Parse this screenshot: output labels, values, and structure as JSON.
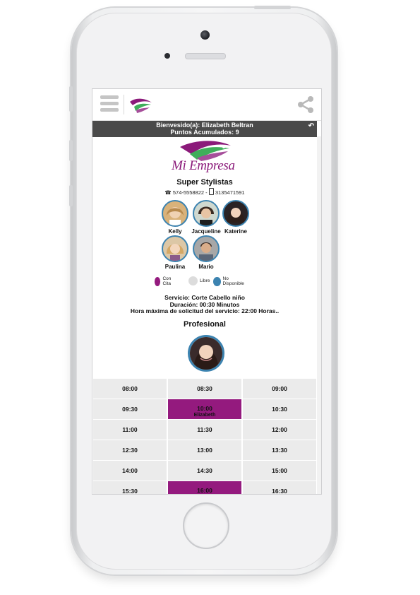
{
  "app": {
    "welcome_line1": "Bienvesido(a): Elizabeth Beltran",
    "welcome_line2": "Puntos Acumulados: 9",
    "brand": "Mi Empresa",
    "icons": [
      "menu-icon",
      "logo-icon",
      "share-icon",
      "back-arrow-icon",
      "phone-icon",
      "mobile-icon"
    ]
  },
  "salon": {
    "name": "Super Stylistas",
    "phone": "574-5558822 -",
    "mobile": "3135471591"
  },
  "stylists": [
    {
      "name": "Kelly"
    },
    {
      "name": "Jacqueline"
    },
    {
      "name": "Katerine"
    },
    {
      "name": "Paulina"
    },
    {
      "name": "Mario"
    }
  ],
  "legend": {
    "con_cita": "Con Cita",
    "libre": "Libre",
    "no_disponible": "No Disponible",
    "colors": {
      "con_cita": "#941a7e",
      "libre": "#dcdcdc",
      "no_disponible": "#3c83b0"
    }
  },
  "service": {
    "servicio": "Servicio: Corte Cabello niño",
    "duracion": "Duración: 00:30 Minutos",
    "hora_maxima": "Hora máxima de solicitud del servicio: 22:00 Horas.."
  },
  "profesional": {
    "title": "Profesional"
  },
  "slots": [
    {
      "time": "08:00",
      "status": "libre",
      "who": ""
    },
    {
      "time": "08:30",
      "status": "libre",
      "who": ""
    },
    {
      "time": "09:00",
      "status": "libre",
      "who": ""
    },
    {
      "time": "09:30",
      "status": "libre",
      "who": ""
    },
    {
      "time": "10:00",
      "status": "con_cita",
      "who": "Elizabeth"
    },
    {
      "time": "10:30",
      "status": "libre",
      "who": ""
    },
    {
      "time": "11:00",
      "status": "libre",
      "who": ""
    },
    {
      "time": "11:30",
      "status": "libre",
      "who": ""
    },
    {
      "time": "12:00",
      "status": "libre",
      "who": ""
    },
    {
      "time": "12:30",
      "status": "libre",
      "who": ""
    },
    {
      "time": "13:00",
      "status": "libre",
      "who": ""
    },
    {
      "time": "13:30",
      "status": "libre",
      "who": ""
    },
    {
      "time": "14:00",
      "status": "libre",
      "who": ""
    },
    {
      "time": "14:30",
      "status": "libre",
      "who": ""
    },
    {
      "time": "15:00",
      "status": "libre",
      "who": ""
    },
    {
      "time": "15:30",
      "status": "libre",
      "who": ""
    },
    {
      "time": "16:00",
      "status": "con_cita",
      "who": ""
    },
    {
      "time": "16:30",
      "status": "libre",
      "who": ""
    }
  ]
}
